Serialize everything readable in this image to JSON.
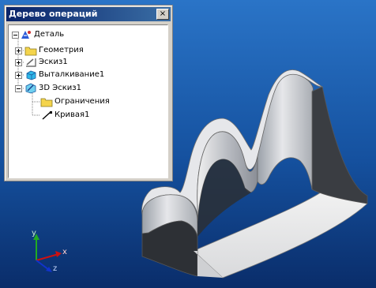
{
  "window": {
    "title": "Дерево операций",
    "close_glyph": "×"
  },
  "tree": {
    "nodes": [
      {
        "label": "Деталь",
        "icon": "part-icon",
        "expander": "minus"
      },
      {
        "label": "Геометрия",
        "icon": "folder-icon",
        "expander": "plus"
      },
      {
        "label": "Эскиз1",
        "icon": "sketch-icon",
        "expander": "plus"
      },
      {
        "label": "Выталкивание1",
        "icon": "extrude-icon",
        "expander": "plus"
      },
      {
        "label": "3D Эскиз1",
        "icon": "sketch3d-icon",
        "expander": "minus"
      },
      {
        "label": "Ограничения",
        "icon": "folder-icon",
        "expander": "none"
      },
      {
        "label": "Кривая1",
        "icon": "curve-icon",
        "expander": "none"
      }
    ]
  },
  "axes": {
    "x": "x",
    "y": "y",
    "z": "z"
  },
  "colors": {
    "bg_top": "#1d63b5",
    "bg_bottom": "#0a2e6b",
    "panel": "#d4d0c8",
    "title_start": "#0a246a",
    "title_end": "#3a6ea5",
    "axis_x": "#cc1111",
    "axis_y": "#22aa22",
    "axis_z": "#1133cc"
  }
}
